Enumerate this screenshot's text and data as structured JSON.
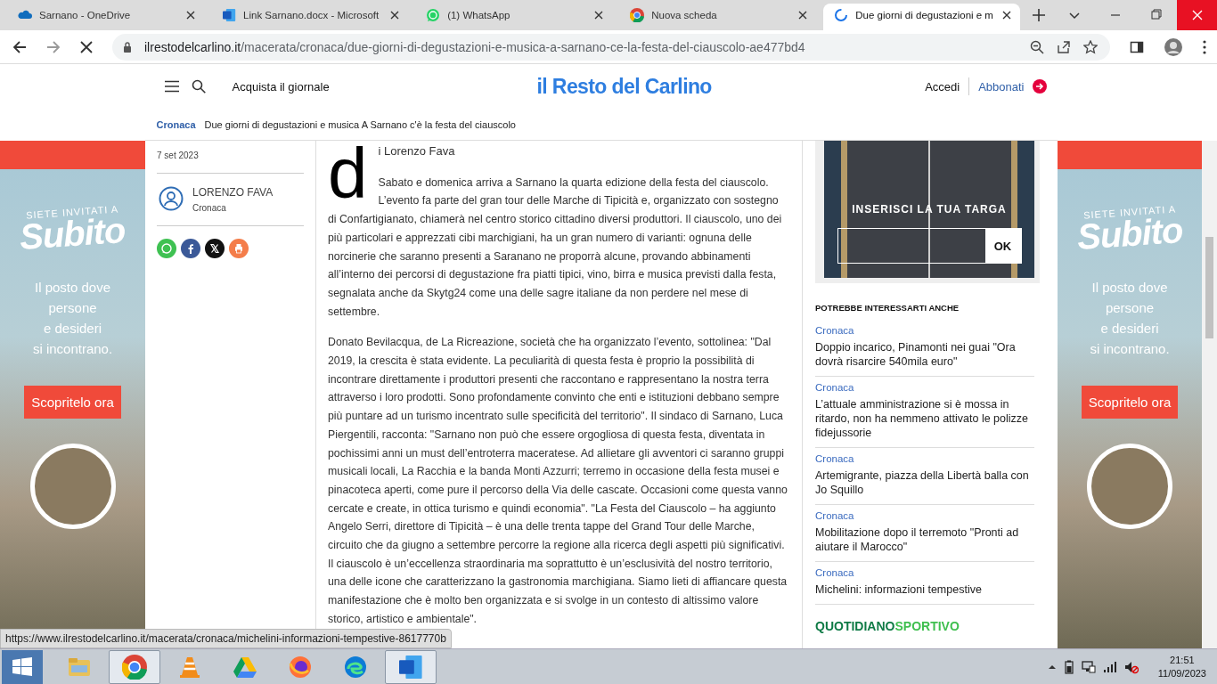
{
  "browser": {
    "tabs": [
      {
        "title": "Sarnano - OneDrive",
        "kind": "cloud",
        "selected": false
      },
      {
        "title": "Link Sarnano.docx - Microsoft",
        "kind": "word",
        "selected": false
      },
      {
        "title": "(1) WhatsApp",
        "kind": "whatsapp",
        "selected": false
      },
      {
        "title": "Nuova scheda",
        "kind": "chrome",
        "selected": false
      },
      {
        "title": "Due giorni di degustazioni e m",
        "kind": "site",
        "selected": true
      }
    ],
    "url_host": "ilrestodelcarlino.it",
    "url_path": "/macerata/cronaca/due-giorni-di-degustazioni-e-musica-a-sarnano-ce-la-festa-del-ciauscolo-ae477bd4",
    "loading": true
  },
  "header": {
    "buy_link": "Acquista il giornale",
    "logo": "il Resto del Carlino",
    "login": "Accedi",
    "subscribe": "Abbonati"
  },
  "breadcrumb": {
    "section": "Cronaca",
    "title": "Due giorni di degustazioni e musica A Sarnano c'è la festa del ciauscolo"
  },
  "ads": [
    {
      "kicker": "SIETE INVITATI A",
      "brand": "Subito",
      "tagline": [
        "Il posto dove",
        "persone",
        "e desideri",
        "si incontrano."
      ],
      "cta": "Scopritelo ora"
    },
    {
      "kicker": "SIETE INVITATI A",
      "brand": "Subito",
      "tagline": [
        "Il posto dove",
        "persone",
        "e desideri",
        "si incontrano."
      ],
      "cta": "Scopritelo ora"
    }
  ],
  "article": {
    "date": "7 set 2023",
    "author": {
      "name": "LORENZO FAVA",
      "section": "Cronaca"
    },
    "share": [
      {
        "kind": "whatsapp"
      },
      {
        "kind": "facebook"
      },
      {
        "kind": "x"
      },
      {
        "kind": "print"
      }
    ],
    "drop_cap": "d",
    "byline": "i Lorenzo Fava",
    "paragraphs": [
      "Sabato e domenica arriva a Sarnano la quarta edizione della festa del ciauscolo. L’evento fa parte del gran tour delle Marche di Tipicità e, organizzato con sostegno di Confartigianato, chiamerà nel centro storico cittadino diversi produttori. Il ciauscolo, uno dei più particolari e apprezzati cibi marchigiani, ha un gran numero di varianti: ognuna delle norcinerie che saranno presenti a Saranano ne proporrà alcune, provando abbinamenti all’interno dei percorsi di degustazione fra piatti tipici, vino, birra e musica previsti dalla festa, segnalata anche da Skytg24 come una delle sagre italiane da non perdere nel mese di settembre.",
      "Donato Bevilacqua, de La Ricreazione, società che ha organizzato l’evento, sottolinea: \"Dal 2019, la crescita è stata evidente. La peculiarità di questa festa è proprio la possibilità di incontrare direttamente i produttori presenti che raccontano e rappresentano la nostra terra attraverso i loro prodotti. Sono profondamente convinto che enti e istituzioni debbano sempre più puntare ad un turismo incentrato sulle specificità del territorio\". Il sindaco di Sarnano, Luca Piergentili, racconta: \"Sarnano non può che essere orgogliosa di questa festa, diventata in pochissimi anni un must dell’entroterra maceratese. Ad allietare gli avventori ci saranno gruppi musicali locali, La Racchia e la banda Monti Azzurri; terremo in occasione della festa musei e pinacoteca aperti, come pure il percorso della Via delle cascate. Occasioni come questa vanno cercate e create, in ottica turismo e quindi economia\". \"La Festa del Ciauscolo – ha aggiunto Angelo Serri, direttore di Tipicità – è una delle trenta tappe del Grand Tour delle Marche, circuito che da giugno a settembre percorre la regione alla ricerca degli aspetti più significativi. Il ciauscolo è un’eccellenza straordinaria ma soprattutto è un’esclusività del nostro territorio, una delle icone che caratterizzano la gastronomia marchigiana. Siamo lieti di affiancare questa manifestazione che è molto ben organizzata e si svolge in un contesto di altissimo valore storico, artistico e ambientale\"."
    ]
  },
  "sidebar": {
    "ad": {
      "headline": "INSERISCI LA TUA TARGA",
      "button": "OK"
    },
    "related_heading": "POTREBBE INTERESSARTI ANCHE",
    "related": [
      {
        "section": "Cronaca",
        "title": "Doppio incarico, Pinamonti nei guai \"Ora dovrà risarcire 540mila euro\""
      },
      {
        "section": "Cronaca",
        "title": "L’attuale amministrazione si è mossa in ritardo, non ha nemmeno attivato le polizze fidejussorie"
      },
      {
        "section": "Cronaca",
        "title": "Artemigrante, piazza della Libertà balla con Jo Squillo"
      },
      {
        "section": "Cronaca",
        "title": "Mobilitazione dopo il terremoto \"Pronti ad aiutare il Marocco\""
      },
      {
        "section": "Cronaca",
        "title": "Michelini: informazioni tempestive"
      }
    ],
    "sport_logo": [
      "QUOTIDIANO",
      "SPORTIVO"
    ]
  },
  "status_url": "https://www.ilrestodelcarlino.it/macerata/cronaca/michelini-informazioni-tempestive-8617770b",
  "taskbar": {
    "apps": [
      {
        "kind": "explorer",
        "active": false
      },
      {
        "kind": "chrome",
        "active": true
      },
      {
        "kind": "vlc",
        "active": false
      },
      {
        "kind": "drive",
        "active": false
      },
      {
        "kind": "firefox",
        "active": false
      },
      {
        "kind": "edge",
        "active": false
      },
      {
        "kind": "word",
        "active": true
      }
    ],
    "time": "21:51",
    "date": "11/09/2023"
  }
}
